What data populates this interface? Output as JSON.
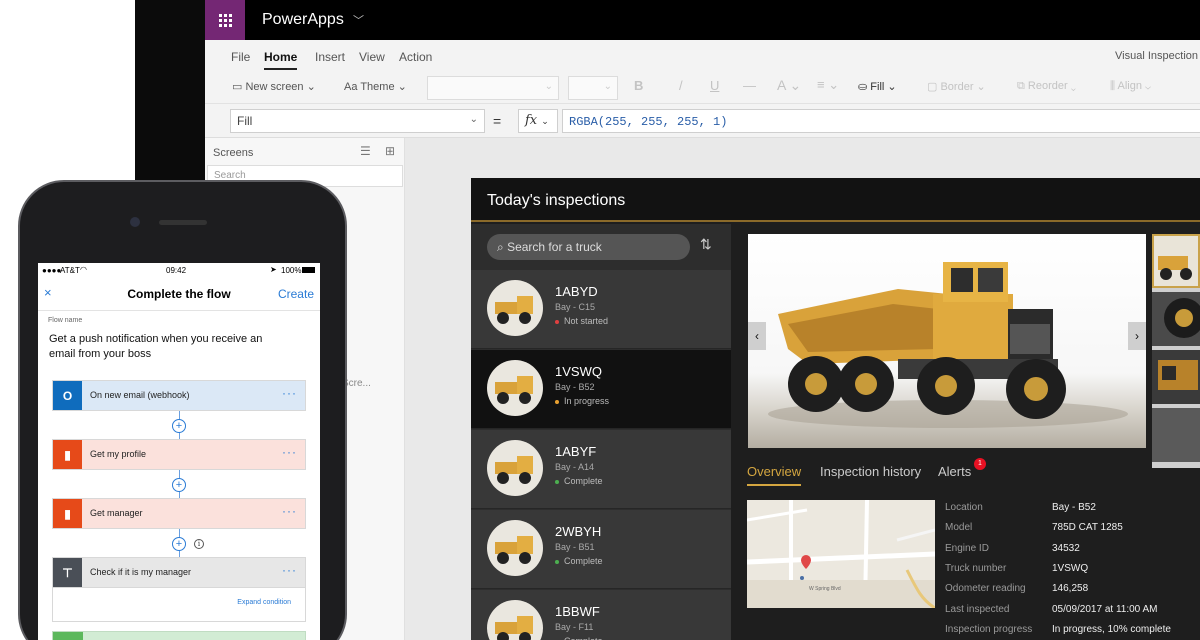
{
  "powerapps": {
    "app_name": "PowerApps",
    "menu": [
      "File",
      "Home",
      "Insert",
      "View",
      "Action"
    ],
    "active_menu": "Home",
    "doc_title": "Visual Inspection",
    "ribbon": {
      "new_screen": "New screen",
      "theme": "Theme",
      "bold": "B",
      "italic": "/",
      "underline": "U",
      "strike": "—",
      "font_size": "A",
      "fill": "Fill",
      "border": "Border",
      "reorder": "Reorder",
      "align": "Align"
    },
    "formula": {
      "property": "Fill",
      "equals": "=",
      "fx": "fx",
      "value": "RGBA(255, 255, 255, 1)"
    },
    "screens_panel": {
      "title": "Screens",
      "search_placeholder": "Search",
      "truncated_item": "Scre..."
    }
  },
  "inspection_app": {
    "title": "Today's inspections",
    "search_placeholder": "Search for a truck",
    "trucks": [
      {
        "id": "1ABYD",
        "bay": "Bay - C15",
        "status": "Not started",
        "status_color": "#e04040"
      },
      {
        "id": "1VSWQ",
        "bay": "Bay - B52",
        "status": "In progress",
        "status_color": "#e8a030"
      },
      {
        "id": "1ABYF",
        "bay": "Bay - A14",
        "status": "Complete",
        "status_color": "#4caf50"
      },
      {
        "id": "2WBYH",
        "bay": "Bay - B51",
        "status": "Complete",
        "status_color": "#4caf50"
      },
      {
        "id": "1BBWF",
        "bay": "Bay - F11",
        "status": "Complete",
        "status_color": "#4caf50"
      }
    ],
    "selected_truck": "1VSWQ",
    "tabs": [
      "Overview",
      "Inspection history",
      "Alerts"
    ],
    "active_tab": "Overview",
    "alerts_count": "1",
    "details": [
      {
        "label": "Location",
        "value": "Bay - B52"
      },
      {
        "label": "Model",
        "value": "785D CAT 1285"
      },
      {
        "label": "Engine ID",
        "value": "34532"
      },
      {
        "label": "Truck number",
        "value": "1VSWQ"
      },
      {
        "label": "Odometer reading",
        "value": "146,258"
      },
      {
        "label": "Last inspected",
        "value": "05/09/2017 at 11:00 AM"
      },
      {
        "label": "Inspection progress",
        "value": "In progress, 10% complete"
      }
    ],
    "map_street": "W Spring Blvd"
  },
  "phone": {
    "status": {
      "carrier": "AT&T",
      "time": "09:42",
      "battery": "100%"
    },
    "nav": {
      "close": "×",
      "title": "Complete the flow",
      "create": "Create"
    },
    "flow_label": "Flow name",
    "flow_name": "Get a push notification when you receive an email from your boss",
    "steps": [
      {
        "label": "On new email (webhook)",
        "bg": "#dbe8f6",
        "icon_bg": "#0f6cbd"
      },
      {
        "label": "Get my profile",
        "bg": "#fbe1dc",
        "icon_bg": "#e64a19"
      },
      {
        "label": "Get manager",
        "bg": "#fbe1dc",
        "icon_bg": "#e64a19"
      },
      {
        "label": "Check if it is my manager",
        "bg": "#e7e7e7",
        "icon_bg": "#4a4f57"
      }
    ],
    "more": "···",
    "expand_condition": "Expand condition",
    "info": "i",
    "plus": "+"
  },
  "colors": {
    "powerapps_purple": "#742774",
    "accent_gold": "#d4a640",
    "link_blue": "#2a7bd5"
  }
}
